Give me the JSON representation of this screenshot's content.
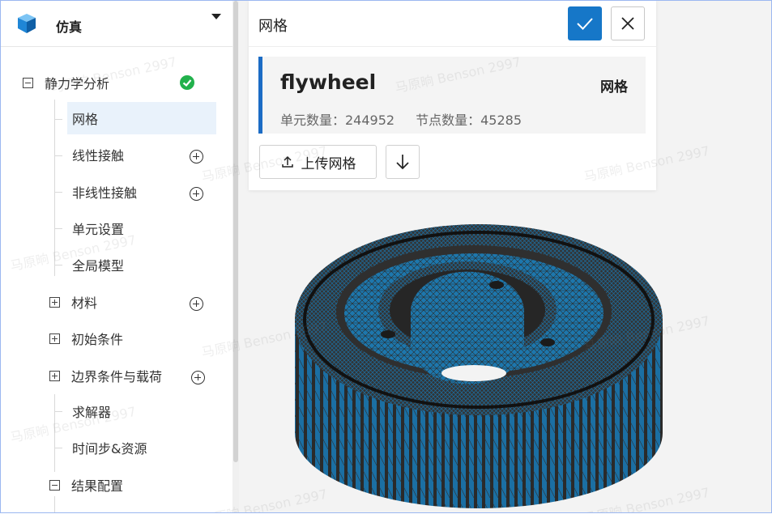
{
  "app": {
    "title": "仿真"
  },
  "tree": {
    "root": {
      "label": "静力学分析",
      "status": "complete"
    },
    "items": [
      {
        "label": "网格"
      },
      {
        "label": "线性接触"
      },
      {
        "label": "非线性接触"
      },
      {
        "label": "单元设置"
      },
      {
        "label": "全局模型"
      },
      {
        "label": "材料"
      },
      {
        "label": "初始条件"
      },
      {
        "label": "边界条件与载荷"
      },
      {
        "label": "求解器"
      },
      {
        "label": "时间步&资源"
      },
      {
        "label": "结果配置"
      }
    ]
  },
  "panel": {
    "title": "网格",
    "mesh": {
      "name": "flywheel",
      "type_label": "网格",
      "element_count_label": "单元数量：244952",
      "node_count_label": "节点数量：45285"
    },
    "upload_label": "上传网格"
  },
  "watermark": "马原晌 Benson 2997",
  "colors": {
    "accent": "#1677c8",
    "success": "#22b14c",
    "selected_bg": "#e9f2fb",
    "mesh_fill": "#1b6fa3",
    "mesh_line": "#2d2d2d"
  },
  "icons": {
    "logo": "cube-icon",
    "confirm": "check-icon",
    "close": "close-icon",
    "upload": "upload-icon",
    "download": "arrow-down-icon"
  }
}
